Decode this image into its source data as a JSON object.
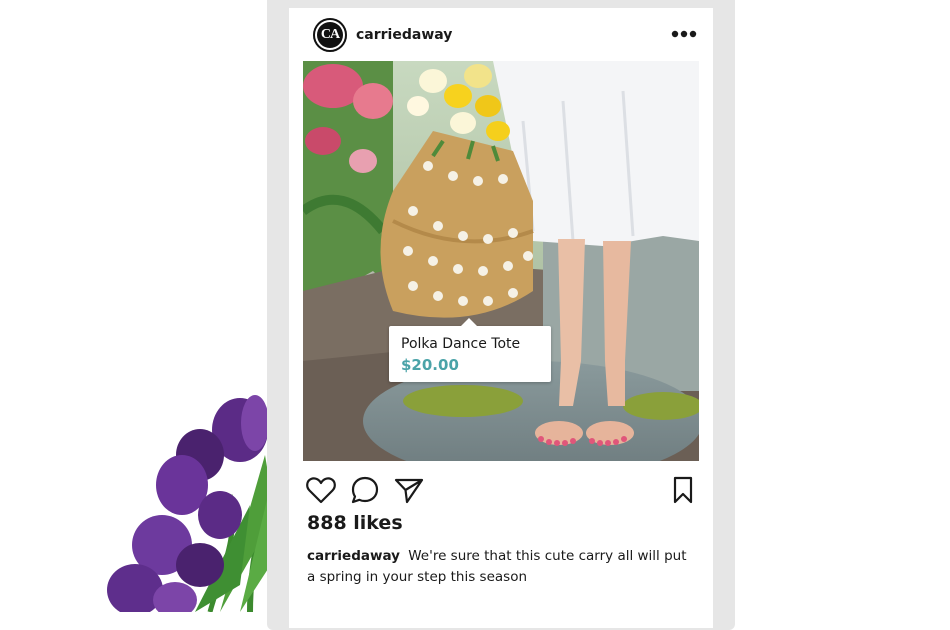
{
  "post": {
    "avatar_text": "CA",
    "username": "carriedaway",
    "more_icon": "more-horizontal-icon",
    "image_alt": "Person in white dress holding a polka dot straw tote with yellow flowers on a garden path",
    "product_tag": {
      "name": "Polka Dance Tote",
      "price": "$20.00"
    },
    "actions": {
      "like_icon": "heart-icon",
      "comment_icon": "comment-icon",
      "share_icon": "send-icon",
      "save_icon": "bookmark-icon"
    },
    "likes": "888 likes",
    "caption": {
      "username": "carriedaway",
      "text": "We're sure that this  cute carry all will put a spring in your step this season"
    }
  },
  "colors": {
    "price": "#4aa3a8",
    "frame": "#e6e6e6"
  }
}
